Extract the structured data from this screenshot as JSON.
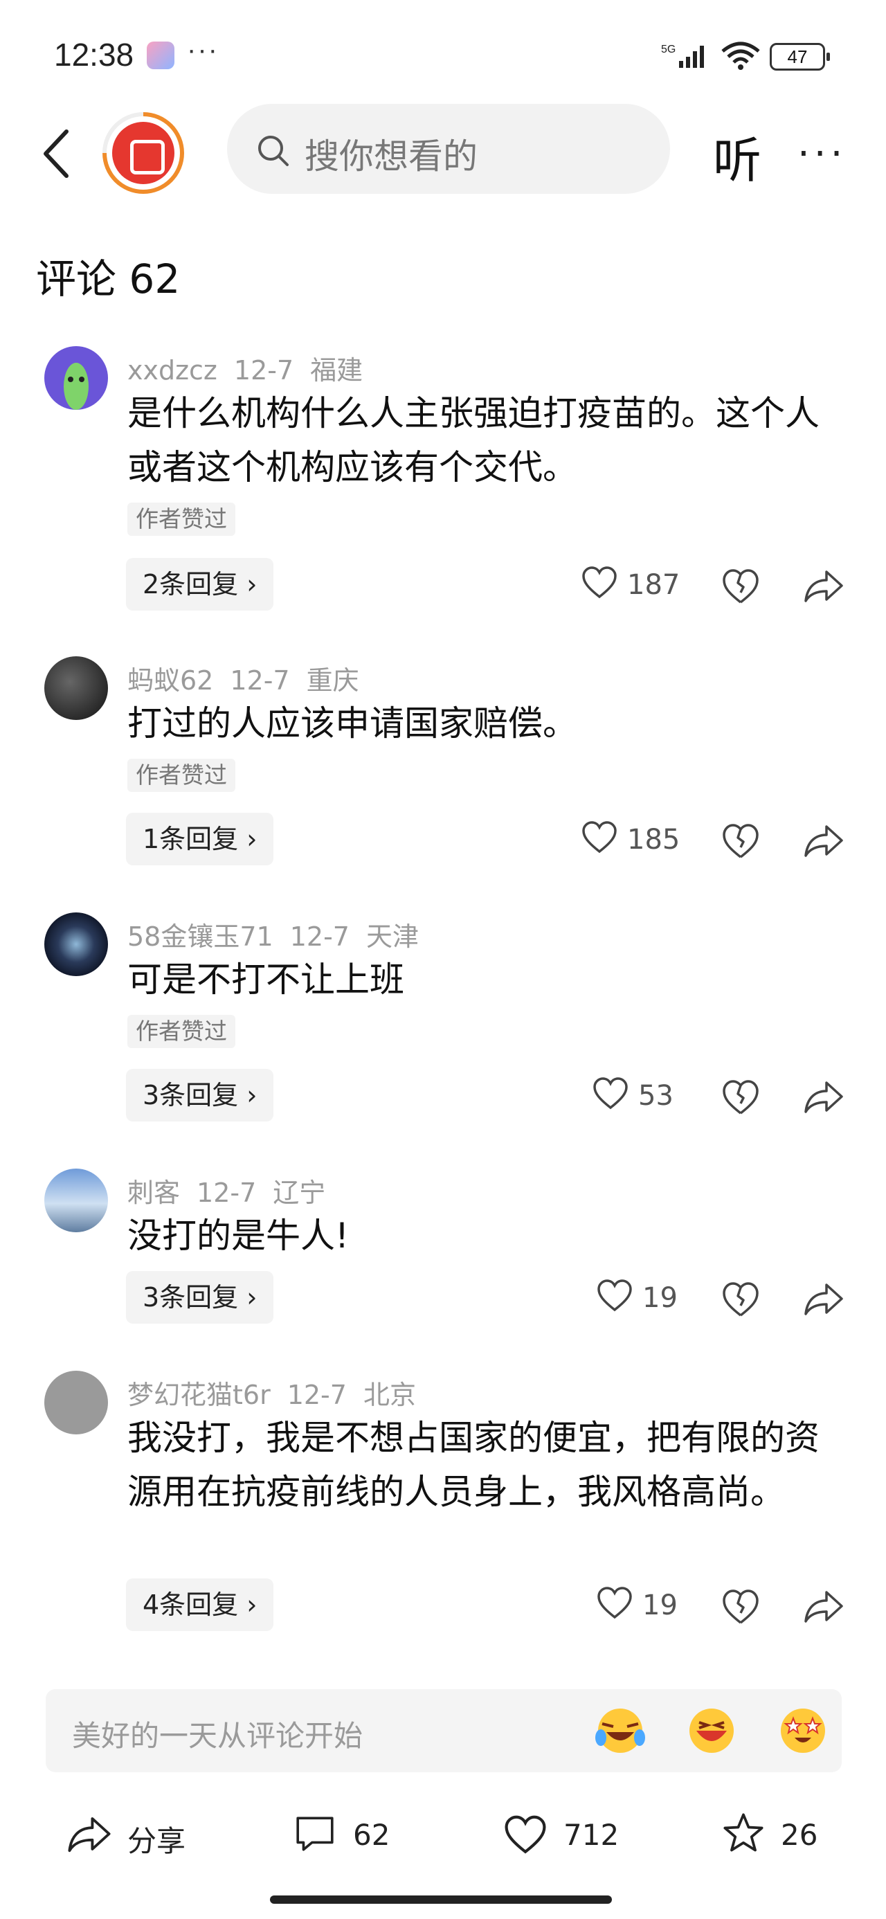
{
  "status": {
    "time": "12:38",
    "network": "5G",
    "battery": "47"
  },
  "nav": {
    "search_placeholder": "搜你想看的",
    "listen_label": "听",
    "more_label": "···"
  },
  "comments_header": "评论 62",
  "comments": [
    {
      "user": "xxdzcz",
      "date": "12-7",
      "location": "福建",
      "text": "是什么机构什么人主张强迫打疫苗的。这个人或者这个机构应该有个交代。",
      "tag": "作者赞过",
      "replies": "2条回复 ›",
      "likes": "187"
    },
    {
      "user": "蚂蚁62",
      "date": "12-7",
      "location": "重庆",
      "text": "打过的人应该申请国家赔偿。",
      "tag": "作者赞过",
      "replies": "1条回复 ›",
      "likes": "185"
    },
    {
      "user": "58金镶玉71",
      "date": "12-7",
      "location": "天津",
      "text": "可是不打不让上班",
      "tag": "作者赞过",
      "replies": "3条回复 ›",
      "likes": "53"
    },
    {
      "user": "刺客",
      "date": "12-7",
      "location": "辽宁",
      "text": "没打的是牛人!",
      "tag": "",
      "replies": "3条回复 ›",
      "likes": "19"
    },
    {
      "user": "梦幻花猫t6r",
      "date": "12-7",
      "location": "北京",
      "text": "我没打，我是不想占国家的便宜，把有限的资源用在抗疫前线的人员身上，我风格高尚。",
      "tag": "",
      "replies": "4条回复 ›",
      "likes": "19"
    }
  ],
  "input": {
    "placeholder": "美好的一天从评论开始"
  },
  "bottom": {
    "share_label": "分享",
    "comment_count": "62",
    "like_count": "712",
    "star_count": "26"
  },
  "colors": {
    "accent_red": "#e5372f",
    "accent_orange": "#f08c2a"
  }
}
